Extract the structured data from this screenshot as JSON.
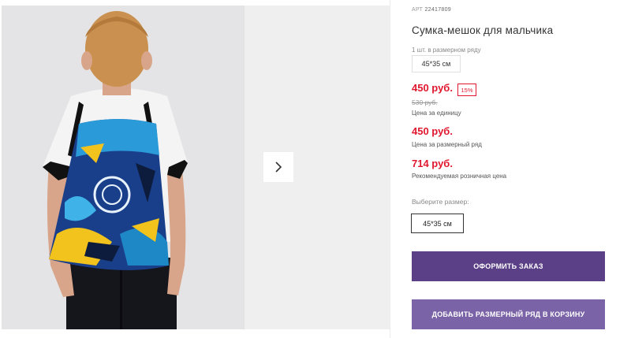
{
  "product": {
    "art_label": "АРТ",
    "art_number": "22417809",
    "title": "Сумка-мешок для мальчика",
    "pack_label": "1 шт. в размерном ряду",
    "pack_size": "45*35 см"
  },
  "prices": {
    "unit_price": "450 руб.",
    "discount": "15%",
    "old_price": "530 руб.",
    "unit_caption": "Цена за единицу",
    "pack_price": "450 руб.",
    "pack_caption": "Цена за размерный ряд",
    "retail_price": "714 руб.",
    "retail_caption": "Рекомендуемая розничная цена"
  },
  "size_selector": {
    "label": "Выберите размер:",
    "options": [
      "45*35 см"
    ]
  },
  "actions": {
    "order_label": "ОФОРМИТЬ ЗАКАЗ",
    "cart_label": "ДОБАВИТЬ РАЗМЕРНЫЙ РЯД В КОРЗИНУ"
  },
  "gallery": {
    "next_icon": "chevron-right-icon"
  },
  "colors": {
    "price_red": "#e0172e",
    "primary_button": "#5b3f87",
    "secondary_button": "#7b63a8"
  }
}
